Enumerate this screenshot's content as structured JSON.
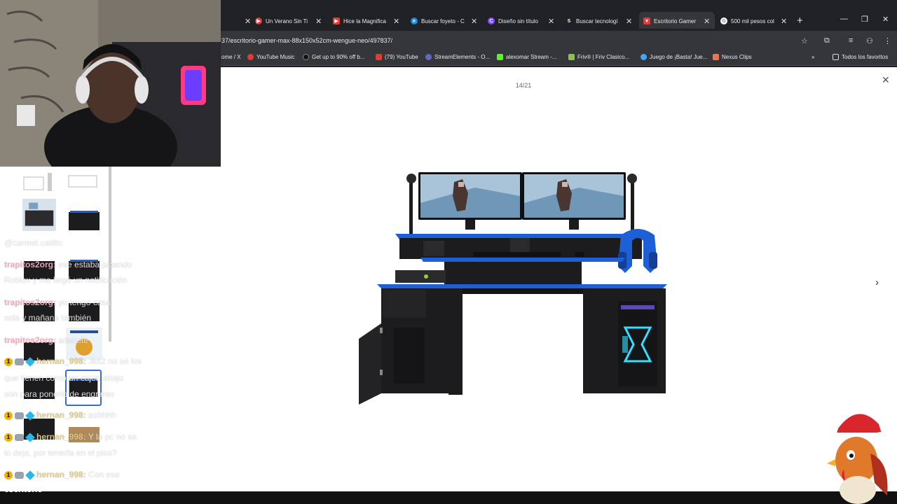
{
  "browser": {
    "tabs": [
      {
        "title": "Un Verano Sin Ti",
        "icon": "youtube-music-icon",
        "color": "#e53935"
      },
      {
        "title": "Hice la Magnifica",
        "icon": "youtube-icon",
        "color": "#e53935"
      },
      {
        "title": "Buscar foyeto - C",
        "icon": "edge-icon",
        "color": "#1e88e5"
      },
      {
        "title": "Diseño sin título",
        "icon": "canva-icon",
        "color": "#7c4dff"
      },
      {
        "title": "Buscar tecnologí",
        "icon": "s-icon",
        "color": "#333333"
      },
      {
        "title": "Escritorio Gamer",
        "icon": "store-icon",
        "color": "#e53935"
      },
      {
        "title": "500 mil pesos col",
        "icon": "google-icon",
        "color": "#ffffff"
      }
    ],
    "url": "37/escritorio-gamer-max-88x150x52cm-wengue-neo/497837/",
    "bookmarks": [
      {
        "label": "ome / X",
        "color": "#35363a"
      },
      {
        "label": "YouTube Music",
        "color": "#e53935"
      },
      {
        "label": "Get up to 90% off b...",
        "color": "#111111"
      },
      {
        "label": "(79) YouTube",
        "color": "#e53935"
      },
      {
        "label": "StreamElements - O...",
        "color": "#5c6bc0"
      },
      {
        "label": "alexomar Stream -...",
        "color": "#53fc18"
      },
      {
        "label": "Friv® | Friv Clasico...",
        "color": "#8bc34a"
      },
      {
        "label": "Juego de ¡Basta! Jue...",
        "color": "#42a5f5"
      },
      {
        "label": "Nexus Clips",
        "color": "#ff7043"
      }
    ],
    "all_bookmarks": "Todos los favoritos"
  },
  "viewer": {
    "counter": "14/21",
    "close_glyph": "✕",
    "next_glyph": "›"
  },
  "chat": [
    {
      "user": "",
      "text": "@carmel.catillo:"
    },
    {
      "user": "trapitos2org:",
      "text": "ese estaba jugando"
    },
    {
      "user": "",
      "text": "Roblox y me llegó un notificación"
    },
    {
      "user": "trapitos2org:",
      "text": "yo tengo casa"
    },
    {
      "user": "",
      "text": "sola y mañana también"
    },
    {
      "user": "trapitos2org:",
      "text": "aducete"
    },
    {
      "user": "hernan_998:",
      "text": "Jks2 no sé los"
    },
    {
      "user": "",
      "text": "que tienen como un cajón abajo"
    },
    {
      "user": "",
      "text": "son para ponerlo de engrimer"
    },
    {
      "user": "hernan_998:",
      "text": "ashhhh"
    },
    {
      "user": "hernan_998:",
      "text": "Y la pc no se"
    },
    {
      "user": "",
      "text": "lo deja, por tenerla en el piso?"
    },
    {
      "user": "hernan_998:",
      "text": "Con ese"
    }
  ],
  "bottom_text": "escritorio",
  "colors": {
    "desk_black": "#1c1c1e",
    "desk_blue": "#1d5fd6",
    "led_cyan": "#34e0ff"
  }
}
